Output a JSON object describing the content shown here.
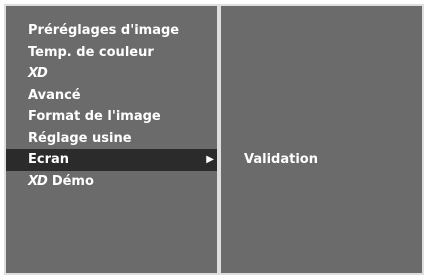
{
  "menu": {
    "items": [
      {
        "label": "Préréglages d'image"
      },
      {
        "label": "Temp. de couleur"
      },
      {
        "label": "XD"
      },
      {
        "label": "Avancé"
      },
      {
        "label": "Format de l'image"
      },
      {
        "label": "Réglage usine"
      },
      {
        "label": "Ecran",
        "selected": true,
        "arrow": "▶"
      },
      {
        "logo": "XD",
        "label": "Démo"
      }
    ]
  },
  "submenu": {
    "items": [
      {
        "label": "Validation"
      }
    ]
  },
  "colors": {
    "panel": "#6b6b6b",
    "border": "#dedede",
    "selected": "#2b2b2b",
    "text": "#ffffff"
  }
}
